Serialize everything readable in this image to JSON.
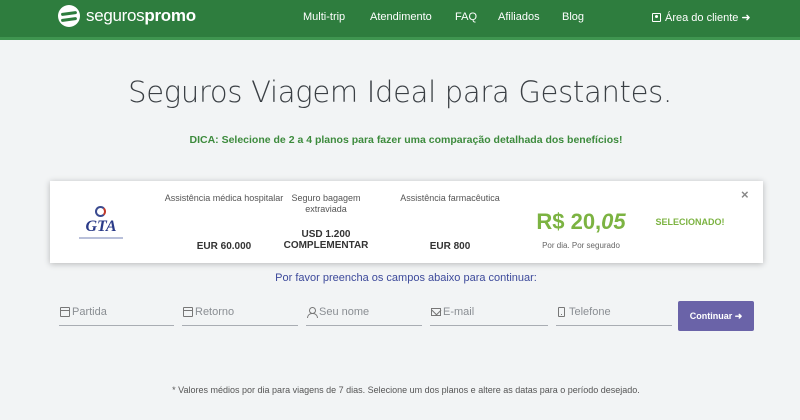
{
  "header": {
    "brand_light": "seguros",
    "brand_bold": "promo",
    "nav": [
      {
        "label": "Multi-trip"
      },
      {
        "label": "Atendimento"
      },
      {
        "label": "FAQ"
      },
      {
        "label": "Afiliados"
      },
      {
        "label": "Blog"
      }
    ],
    "client_area": "Área do cliente ➜"
  },
  "main": {
    "title": "Seguros Viagem Ideal para Gestantes.",
    "tip": "DICA: Selecione de 2 a 4 planos para fazer uma comparação detalhada dos benefícios!"
  },
  "plan": {
    "provider_logo_text": "GTA",
    "coverages": [
      {
        "label": "Assistência médica hospitalar",
        "value": "EUR 60.000"
      },
      {
        "label": "Seguro bagagem extraviada",
        "value": "USD 1.200 COMPLEMENTAR"
      },
      {
        "label": "Assistência farmacêutica",
        "value": "EUR 800"
      }
    ],
    "price_int": "R$ 20,",
    "price_dec": "05",
    "price_note": "Por dia. Por segurado",
    "status": "SELECIONADO!",
    "close_icon": "×"
  },
  "form": {
    "prompt": "Por favor preencha os campos abaixo para continuar:",
    "fields": [
      {
        "placeholder": "Partida",
        "icon": "calendar-icon"
      },
      {
        "placeholder": "Retorno",
        "icon": "calendar-icon"
      },
      {
        "placeholder": "Seu nome",
        "icon": "user-icon"
      },
      {
        "placeholder": "E-mail",
        "icon": "mail-icon"
      },
      {
        "placeholder": "Telefone",
        "icon": "phone-icon"
      }
    ],
    "submit": "Continuar ➜"
  },
  "footnote": "* Valores médios por dia para viagens de 7 dias. Selecione um dos planos e altere as datas para o período desejado.",
  "colors": {
    "header_green": "#2e7d3e",
    "price_green": "#7cb342",
    "button_purple": "#6a63a8"
  }
}
